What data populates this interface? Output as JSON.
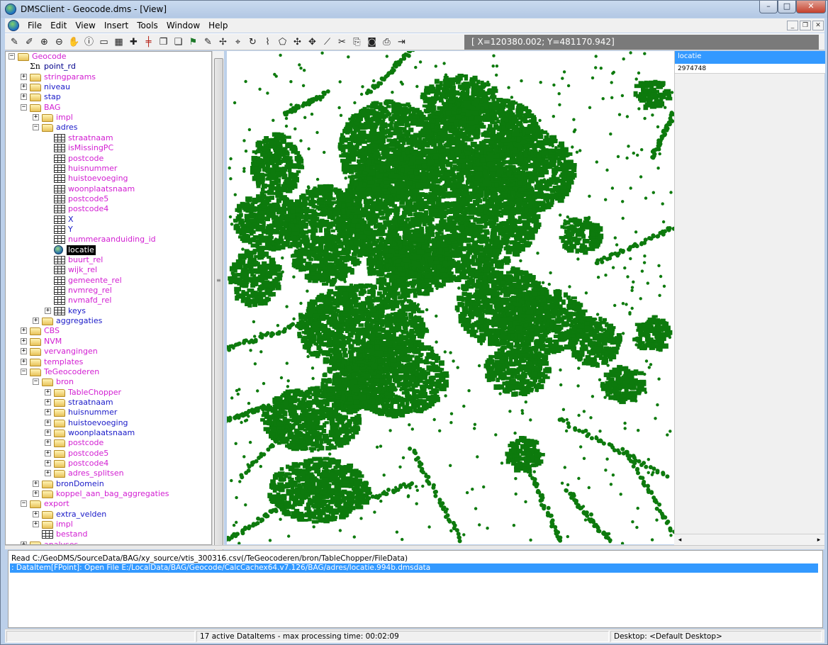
{
  "window": {
    "title": "DMSClient - Geocode.dms - [View]",
    "caption_buttons": [
      "–",
      "□",
      "✕"
    ]
  },
  "menu": {
    "items": [
      "File",
      "Edit",
      "View",
      "Insert",
      "Tools",
      "Window",
      "Help"
    ],
    "mdi_buttons": [
      "_",
      "❐",
      "✕"
    ]
  },
  "toolbar": {
    "coordinate_readout": "[ X=120380.002; Y=481170.942]"
  },
  "tree": {
    "nodes": [
      {
        "label": "Geocode",
        "icon": "folder",
        "color": "magenta",
        "expander": "−"
      },
      {
        "label": "point_rd",
        "icon": "sigma",
        "color": "navy",
        "expander": ""
      },
      {
        "label": "stringparams",
        "icon": "folder",
        "color": "magenta",
        "expander": "+"
      },
      {
        "label": "niveau",
        "icon": "folder",
        "color": "blue",
        "expander": "+"
      },
      {
        "label": "stap",
        "icon": "folder",
        "color": "blue",
        "expander": "+"
      },
      {
        "label": "BAG",
        "icon": "folder",
        "color": "magenta",
        "expander": "−"
      },
      {
        "label": "impl",
        "icon": "folder",
        "color": "magenta",
        "expander": "+"
      },
      {
        "label": "adres",
        "icon": "folder",
        "color": "blue",
        "expander": "−"
      },
      {
        "label": "straatnaam",
        "icon": "table",
        "color": "magenta",
        "expander": ""
      },
      {
        "label": "isMissingPC",
        "icon": "table",
        "color": "magenta",
        "expander": ""
      },
      {
        "label": "postcode",
        "icon": "table",
        "color": "magenta",
        "expander": ""
      },
      {
        "label": "huisnummer",
        "icon": "table",
        "color": "magenta",
        "expander": ""
      },
      {
        "label": "huistoevoeging",
        "icon": "table",
        "color": "magenta",
        "expander": ""
      },
      {
        "label": "woonplaatsnaam",
        "icon": "table",
        "color": "magenta",
        "expander": ""
      },
      {
        "label": "postcode5",
        "icon": "table",
        "color": "magenta",
        "expander": ""
      },
      {
        "label": "postcode4",
        "icon": "table",
        "color": "magenta",
        "expander": ""
      },
      {
        "label": "X",
        "icon": "table",
        "color": "blue",
        "expander": ""
      },
      {
        "label": "Y",
        "icon": "table",
        "color": "blue",
        "expander": ""
      },
      {
        "label": "nummeraanduiding_id",
        "icon": "table",
        "color": "magenta",
        "expander": ""
      },
      {
        "label": "locatie",
        "icon": "globe",
        "color": "selected",
        "expander": ""
      },
      {
        "label": "buurt_rel",
        "icon": "table",
        "color": "magenta",
        "expander": ""
      },
      {
        "label": "wijk_rel",
        "icon": "table",
        "color": "magenta",
        "expander": ""
      },
      {
        "label": "gemeente_rel",
        "icon": "table",
        "color": "magenta",
        "expander": ""
      },
      {
        "label": "nvmreg_rel",
        "icon": "table",
        "color": "magenta",
        "expander": ""
      },
      {
        "label": "nvmafd_rel",
        "icon": "table",
        "color": "magenta",
        "expander": ""
      },
      {
        "label": "keys",
        "icon": "table",
        "color": "blue",
        "expander": "+"
      },
      {
        "label": "aggregaties",
        "icon": "folder",
        "color": "blue",
        "expander": "+"
      },
      {
        "label": "CBS",
        "icon": "folder",
        "color": "magenta",
        "expander": "+"
      },
      {
        "label": "NVM",
        "icon": "folder",
        "color": "magenta",
        "expander": "+"
      },
      {
        "label": "vervangingen",
        "icon": "folder",
        "color": "magenta",
        "expander": "+"
      },
      {
        "label": "templates",
        "icon": "folder",
        "color": "magenta",
        "expander": "+"
      },
      {
        "label": "TeGeocoderen",
        "icon": "folder",
        "color": "magenta",
        "expander": "−"
      },
      {
        "label": "bron",
        "icon": "folder",
        "color": "magenta",
        "expander": "−"
      },
      {
        "label": "TableChopper",
        "icon": "folder",
        "color": "magenta",
        "expander": "+"
      },
      {
        "label": "straatnaam",
        "icon": "folder",
        "color": "blue",
        "expander": "+"
      },
      {
        "label": "huisnummer",
        "icon": "folder",
        "color": "blue",
        "expander": "+"
      },
      {
        "label": "huistoevoeging",
        "icon": "folder",
        "color": "blue",
        "expander": "+"
      },
      {
        "label": "woonplaatsnaam",
        "icon": "folder",
        "color": "blue",
        "expander": "+"
      },
      {
        "label": "postcode",
        "icon": "folder",
        "color": "magenta",
        "expander": "+"
      },
      {
        "label": "postcode5",
        "icon": "folder",
        "color": "magenta",
        "expander": "+"
      },
      {
        "label": "postcode4",
        "icon": "folder",
        "color": "magenta",
        "expander": "+"
      },
      {
        "label": "adres_splitsen",
        "icon": "folder",
        "color": "magenta",
        "expander": "+"
      },
      {
        "label": "bronDomein",
        "icon": "folder",
        "color": "blue",
        "expander": "+"
      },
      {
        "label": "koppel_aan_bag_aggregaties",
        "icon": "folder",
        "color": "magenta",
        "expander": "+"
      },
      {
        "label": "export",
        "icon": "folder",
        "color": "magenta",
        "expander": "−"
      },
      {
        "label": "extra_velden",
        "icon": "folder",
        "color": "blue",
        "expander": "+"
      },
      {
        "label": "impl",
        "icon": "folder",
        "color": "magenta",
        "expander": "+"
      },
      {
        "label": "bestand",
        "icon": "table",
        "color": "magenta",
        "expander": ""
      },
      {
        "label": "analyses",
        "icon": "folder",
        "color": "magenta",
        "expander": "+"
      }
    ]
  },
  "map": {
    "layer_color": "#0d7a0d",
    "background": "#ffffff"
  },
  "legend": {
    "header": "locatie",
    "value": "2974748"
  },
  "log": {
    "lines": [
      "Read C:/GeoDMS/SourceData/BAG/xy_source/vtis_300316.csv(/TeGeocoderen/bron/TableChopper/FileData)",
      ": DataItem[FPoint]: Open   File E:/LocalData/BAG/Geocode/CalcCachex64.v7.126/BAG/adres/locatie.994b.dmsdata"
    ]
  },
  "status": {
    "segment1": "",
    "segment2": "17 active DataItems - max processing time: 00:02:09",
    "segment3": "Desktop: <Default Desktop>"
  },
  "colors": {
    "accent": "#3399ff",
    "magenta_item": "#d21ed2",
    "blue_item": "#1a1ac8"
  }
}
